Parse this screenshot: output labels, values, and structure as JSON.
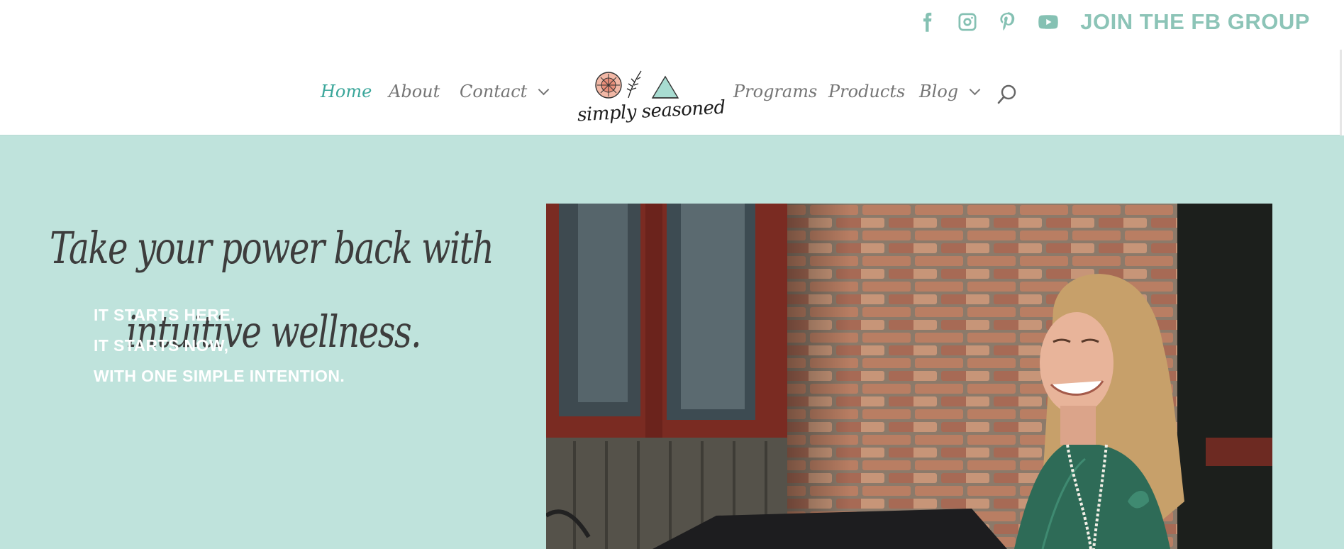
{
  "social": {
    "icons": [
      "facebook-icon",
      "instagram-icon",
      "pinterest-icon",
      "youtube-icon"
    ],
    "fb_group_label": "JOIN THE FB GROUP"
  },
  "nav": {
    "items": [
      {
        "label": "Home",
        "active": true
      },
      {
        "label": "About"
      },
      {
        "label": "Contact",
        "has_dropdown": true
      },
      {
        "label": "Programs"
      },
      {
        "label": "Products"
      },
      {
        "label": "Blog",
        "has_dropdown": true
      }
    ],
    "logo_text": "simply seasoned",
    "search_icon": "search-icon"
  },
  "hero": {
    "headline_line1": "Take your power back with",
    "headline_line2": "intuitive wellness.",
    "tagline": [
      "IT STARTS HERE.",
      "IT STARTS NOW,",
      "WITH ONE SIMPLE INTENTION."
    ]
  },
  "colors": {
    "accent": "#3aa69a",
    "social": "#85c1b3",
    "hero_bg": "#bfe3dc",
    "nav_text": "#757575"
  }
}
